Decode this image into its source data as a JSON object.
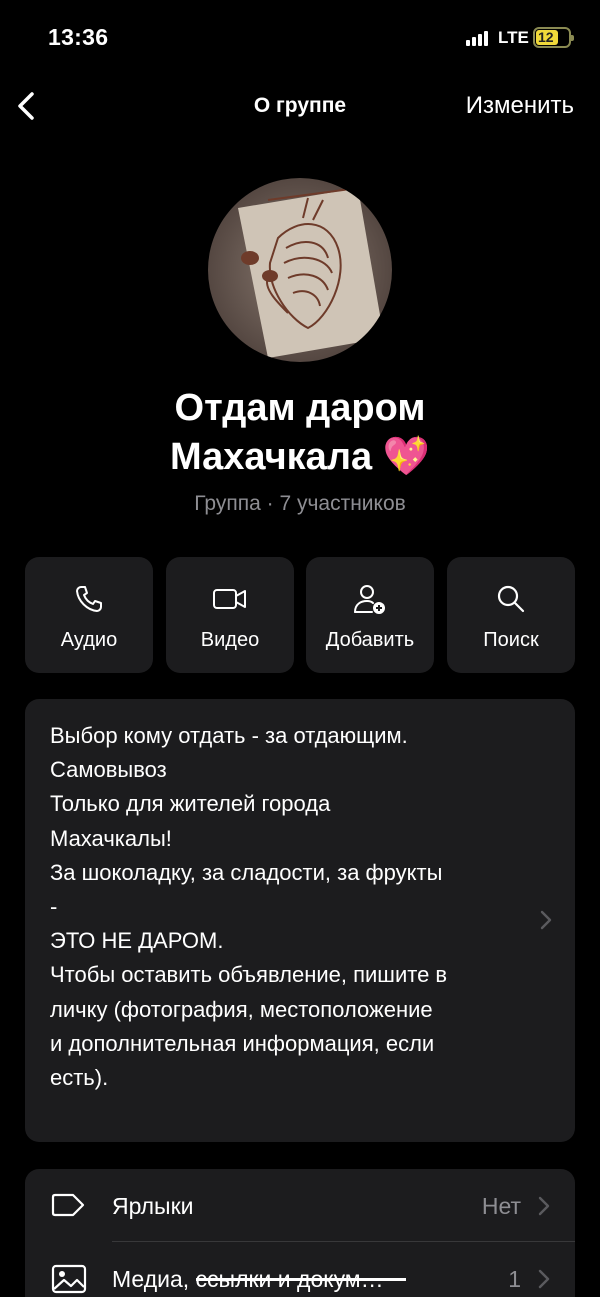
{
  "status": {
    "time": "13:36",
    "network": "LTE",
    "battery": "12"
  },
  "nav": {
    "title": "О группе",
    "edit_label": "Изменить"
  },
  "group": {
    "name_line1": "Отдам даром",
    "name_line2": "Махачкала 💖",
    "subtitle": "Группа · 7 участников"
  },
  "actions": [
    {
      "label": "Аудио",
      "icon": "phone-icon"
    },
    {
      "label": "Видео",
      "icon": "video-icon"
    },
    {
      "label": "Добавить",
      "icon": "add-user-icon"
    },
    {
      "label": "Поиск",
      "icon": "search-icon"
    }
  ],
  "description": "Выбор кому отдать - за отдающим.\nСамовывоз\nТолько для жителей города\nМахачкалы!\nЗа шоколадку, за сладости, за фрукты\n-\nЭТО НЕ ДАРОМ.\nЧтобы оставить объявление, пишите в\nличку (фотография, местоположение\nи дополнительная информация, если\nесть).",
  "list": [
    {
      "label": "Ярлыки",
      "value": "Нет",
      "icon": "tag-icon"
    },
    {
      "label": "Медиа, ссылки и докум…",
      "value": "1",
      "icon": "image-icon"
    }
  ]
}
